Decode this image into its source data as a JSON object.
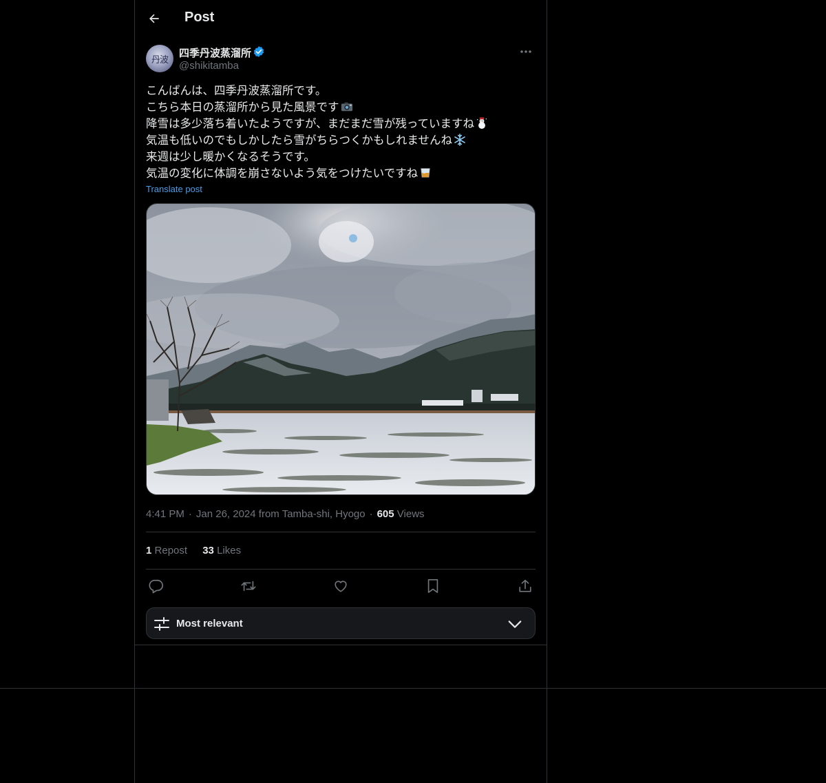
{
  "header": {
    "title": "Post"
  },
  "author": {
    "display_name": "四季丹波蒸溜所",
    "handle": "@shikitamba",
    "avatar_glyph": "丹波"
  },
  "post": {
    "lines": [
      {
        "text": "こんばんは、四季丹波蒸溜所です。",
        "emoji": ""
      },
      {
        "text": "こちら本日の蒸溜所から見た風景です",
        "emoji": "camera-emoji"
      },
      {
        "text": "降雪は多少落ち着いたようですが、まだまだ雪が残っていますね",
        "emoji": "snowman-emoji"
      },
      {
        "text": "気温も低いのでもしかしたら雪がちらつくかもしれませんね",
        "emoji": "snowflake-emoji"
      },
      {
        "text": "来週は少し暖かくなるそうです。",
        "emoji": ""
      },
      {
        "text": "気温の変化に体調を崩さないよう気をつけたいですね",
        "emoji": "whisky-glass-emoji"
      }
    ],
    "translate_label": "Translate post"
  },
  "meta": {
    "time": "4:41 PM",
    "date": "Jan 26, 2024",
    "from_label": "from",
    "location": "Tamba-shi, Hyogo",
    "views_count": "605",
    "views_label": "Views",
    "separator": "·"
  },
  "stats": {
    "reposts_count": "1",
    "reposts_label": "Repost",
    "likes_count": "33",
    "likes_label": "Likes"
  },
  "actions": [
    "reply-icon",
    "repost-icon",
    "like-icon",
    "bookmark-icon",
    "share-icon"
  ],
  "sort": {
    "label": "Most relevant"
  },
  "colors": {
    "background": "#000000",
    "text": "#e7e9ea",
    "muted": "#71767b",
    "link": "#4a9ee9",
    "border": "#2f3336",
    "verified": "#1d9bf0"
  }
}
